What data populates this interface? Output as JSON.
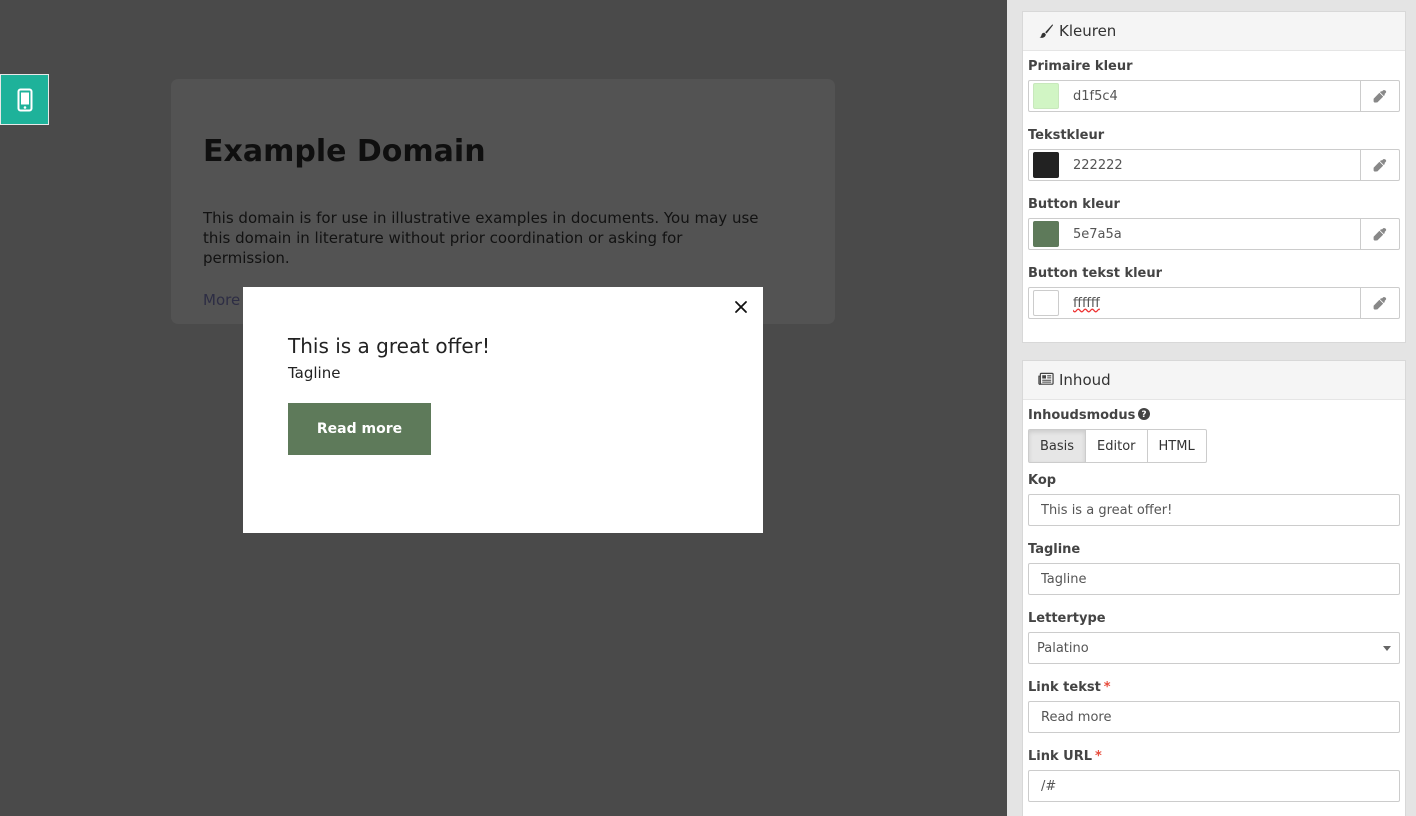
{
  "preview": {
    "device_icon": "mobile-phone-icon",
    "site": {
      "title": "Example Domain",
      "text": "This domain is for use in illustrative examples in documents. You may use this domain in literature without prior coordination or asking for permission.",
      "link": "More information..."
    },
    "popup": {
      "close_icon": "close-icon",
      "title": "This is a great offer!",
      "tagline": "Tagline",
      "button_label": "Read more"
    }
  },
  "colors_panel": {
    "title": "Kleuren",
    "icon": "paint-brush-icon",
    "fields": [
      {
        "label": "Primaire kleur",
        "value": "d1f5c4",
        "swatch": "#d1f5c4"
      },
      {
        "label": "Tekstkleur",
        "value": "222222",
        "swatch": "#222222"
      },
      {
        "label": "Button kleur",
        "value": "5e7a5a",
        "swatch": "#5e7a5a"
      },
      {
        "label": "Button tekst kleur",
        "value": "ffffff",
        "swatch": "#ffffff"
      }
    ],
    "picker_icon": "eyedropper-icon"
  },
  "content_panel": {
    "title": "Inhoud",
    "icon": "newspaper-icon",
    "mode_label": "Inhoudsmodus",
    "mode_help_icon": "question-circle-icon",
    "modes": [
      "Basis",
      "Editor",
      "HTML"
    ],
    "active_mode": "Basis",
    "heading_label": "Kop",
    "heading_value": "This is a great offer!",
    "tagline_label": "Tagline",
    "tagline_value": "Tagline",
    "font_label": "Lettertype",
    "font_value": "Palatino",
    "link_text_label": "Link tekst",
    "link_text_value": "Read more",
    "link_url_label": "Link URL",
    "link_url_value": "/#",
    "required_mark": "*"
  },
  "colors": {
    "accent": "#1eb29a",
    "button": "#5e7a5a",
    "overlay": "#4a4a4a"
  }
}
